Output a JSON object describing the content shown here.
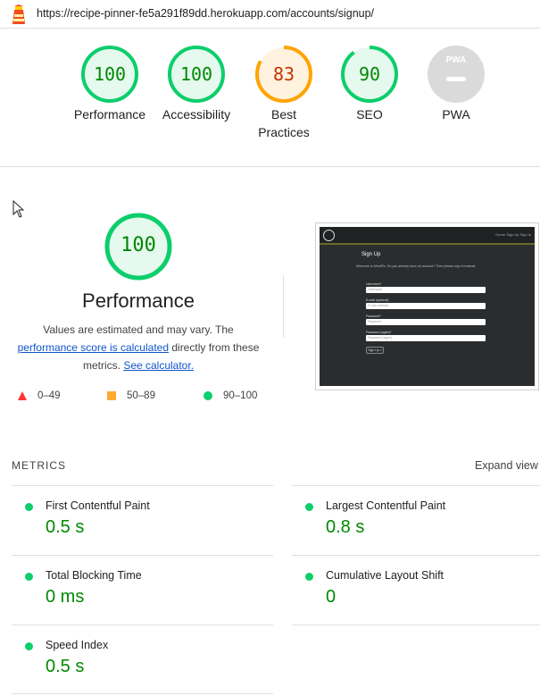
{
  "url": "https://recipe-pinner-fe5a291f89dd.herokuapp.com/accounts/signup/",
  "categories": [
    {
      "label": "Performance",
      "score": "100",
      "level": 100,
      "status": "pass"
    },
    {
      "label": "Accessibility",
      "score": "100",
      "level": 100,
      "status": "pass"
    },
    {
      "label": "Best Practices",
      "score": "83",
      "level": 83,
      "status": "average"
    },
    {
      "label": "SEO",
      "score": "90",
      "level": 90,
      "status": "pass"
    },
    {
      "label": "PWA",
      "score": "PWA",
      "status": "na"
    }
  ],
  "performance": {
    "score": "100",
    "title": "Performance",
    "desc_part1": "Values are estimated and may vary. The ",
    "desc_link1": "performance score is calculated",
    "desc_part2": " directly from these metrics. ",
    "desc_link2": "See calculator."
  },
  "legend": [
    {
      "range": "0–49",
      "shape": "triangle",
      "color": "#ff3333"
    },
    {
      "range": "50–89",
      "shape": "square",
      "color": "#ffaa33"
    },
    {
      "range": "90–100",
      "shape": "circle",
      "color": "#0cce6b"
    }
  ],
  "thumbnail": {
    "nav_links": "Home  Sign Up  Sign In",
    "title": "Sign Up",
    "subtitle": "Welcome to MealPin. Do you already have an account? Then please sign in instead.",
    "fields": [
      {
        "label": "Username*",
        "placeholder": "Username"
      },
      {
        "label": "E-mail (optional)",
        "placeholder": "E-mail address"
      },
      {
        "label": "Password*",
        "placeholder": "Password"
      },
      {
        "label": "Password (again)*",
        "placeholder": "Password (again)"
      }
    ],
    "button": "Sign Up »"
  },
  "metrics_header": "METRICS",
  "expand_label": "Expand view",
  "metrics": [
    {
      "name": "First Contentful Paint",
      "value": "0.5 s"
    },
    {
      "name": "Largest Contentful Paint",
      "value": "0.8 s"
    },
    {
      "name": "Total Blocking Time",
      "value": "0 ms"
    },
    {
      "name": "Cumulative Layout Shift",
      "value": "0"
    },
    {
      "name": "Speed Index",
      "value": "0.5 s"
    }
  ],
  "colors": {
    "pass": "#0cce6b",
    "pass_text": "#008800",
    "average": "#ffa400",
    "average_text": "#c33300",
    "na": "#cccccc",
    "link": "#1155cc"
  },
  "icons": {
    "logo": "lighthouse-icon",
    "cursor": "mouse-pointer-icon"
  }
}
